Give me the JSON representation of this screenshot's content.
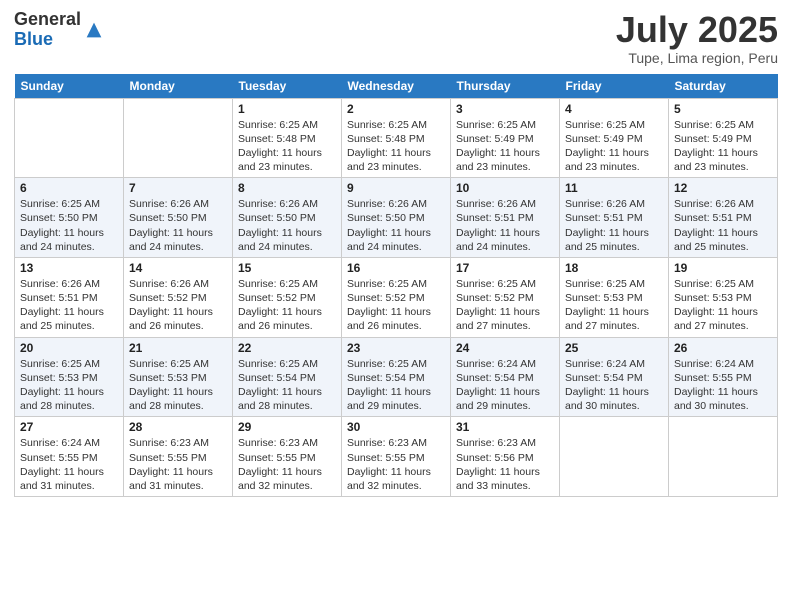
{
  "logo": {
    "general": "General",
    "blue": "Blue"
  },
  "title": "July 2025",
  "location": "Tupe, Lima region, Peru",
  "days_of_week": [
    "Sunday",
    "Monday",
    "Tuesday",
    "Wednesday",
    "Thursday",
    "Friday",
    "Saturday"
  ],
  "weeks": [
    [
      {
        "day": "",
        "info": ""
      },
      {
        "day": "",
        "info": ""
      },
      {
        "day": "1",
        "info": "Sunrise: 6:25 AM\nSunset: 5:48 PM\nDaylight: 11 hours and 23 minutes."
      },
      {
        "day": "2",
        "info": "Sunrise: 6:25 AM\nSunset: 5:48 PM\nDaylight: 11 hours and 23 minutes."
      },
      {
        "day": "3",
        "info": "Sunrise: 6:25 AM\nSunset: 5:49 PM\nDaylight: 11 hours and 23 minutes."
      },
      {
        "day": "4",
        "info": "Sunrise: 6:25 AM\nSunset: 5:49 PM\nDaylight: 11 hours and 23 minutes."
      },
      {
        "day": "5",
        "info": "Sunrise: 6:25 AM\nSunset: 5:49 PM\nDaylight: 11 hours and 23 minutes."
      }
    ],
    [
      {
        "day": "6",
        "info": "Sunrise: 6:25 AM\nSunset: 5:50 PM\nDaylight: 11 hours and 24 minutes."
      },
      {
        "day": "7",
        "info": "Sunrise: 6:26 AM\nSunset: 5:50 PM\nDaylight: 11 hours and 24 minutes."
      },
      {
        "day": "8",
        "info": "Sunrise: 6:26 AM\nSunset: 5:50 PM\nDaylight: 11 hours and 24 minutes."
      },
      {
        "day": "9",
        "info": "Sunrise: 6:26 AM\nSunset: 5:50 PM\nDaylight: 11 hours and 24 minutes."
      },
      {
        "day": "10",
        "info": "Sunrise: 6:26 AM\nSunset: 5:51 PM\nDaylight: 11 hours and 24 minutes."
      },
      {
        "day": "11",
        "info": "Sunrise: 6:26 AM\nSunset: 5:51 PM\nDaylight: 11 hours and 25 minutes."
      },
      {
        "day": "12",
        "info": "Sunrise: 6:26 AM\nSunset: 5:51 PM\nDaylight: 11 hours and 25 minutes."
      }
    ],
    [
      {
        "day": "13",
        "info": "Sunrise: 6:26 AM\nSunset: 5:51 PM\nDaylight: 11 hours and 25 minutes."
      },
      {
        "day": "14",
        "info": "Sunrise: 6:26 AM\nSunset: 5:52 PM\nDaylight: 11 hours and 26 minutes."
      },
      {
        "day": "15",
        "info": "Sunrise: 6:25 AM\nSunset: 5:52 PM\nDaylight: 11 hours and 26 minutes."
      },
      {
        "day": "16",
        "info": "Sunrise: 6:25 AM\nSunset: 5:52 PM\nDaylight: 11 hours and 26 minutes."
      },
      {
        "day": "17",
        "info": "Sunrise: 6:25 AM\nSunset: 5:52 PM\nDaylight: 11 hours and 27 minutes."
      },
      {
        "day": "18",
        "info": "Sunrise: 6:25 AM\nSunset: 5:53 PM\nDaylight: 11 hours and 27 minutes."
      },
      {
        "day": "19",
        "info": "Sunrise: 6:25 AM\nSunset: 5:53 PM\nDaylight: 11 hours and 27 minutes."
      }
    ],
    [
      {
        "day": "20",
        "info": "Sunrise: 6:25 AM\nSunset: 5:53 PM\nDaylight: 11 hours and 28 minutes."
      },
      {
        "day": "21",
        "info": "Sunrise: 6:25 AM\nSunset: 5:53 PM\nDaylight: 11 hours and 28 minutes."
      },
      {
        "day": "22",
        "info": "Sunrise: 6:25 AM\nSunset: 5:54 PM\nDaylight: 11 hours and 28 minutes."
      },
      {
        "day": "23",
        "info": "Sunrise: 6:25 AM\nSunset: 5:54 PM\nDaylight: 11 hours and 29 minutes."
      },
      {
        "day": "24",
        "info": "Sunrise: 6:24 AM\nSunset: 5:54 PM\nDaylight: 11 hours and 29 minutes."
      },
      {
        "day": "25",
        "info": "Sunrise: 6:24 AM\nSunset: 5:54 PM\nDaylight: 11 hours and 30 minutes."
      },
      {
        "day": "26",
        "info": "Sunrise: 6:24 AM\nSunset: 5:55 PM\nDaylight: 11 hours and 30 minutes."
      }
    ],
    [
      {
        "day": "27",
        "info": "Sunrise: 6:24 AM\nSunset: 5:55 PM\nDaylight: 11 hours and 31 minutes."
      },
      {
        "day": "28",
        "info": "Sunrise: 6:23 AM\nSunset: 5:55 PM\nDaylight: 11 hours and 31 minutes."
      },
      {
        "day": "29",
        "info": "Sunrise: 6:23 AM\nSunset: 5:55 PM\nDaylight: 11 hours and 32 minutes."
      },
      {
        "day": "30",
        "info": "Sunrise: 6:23 AM\nSunset: 5:55 PM\nDaylight: 11 hours and 32 minutes."
      },
      {
        "day": "31",
        "info": "Sunrise: 6:23 AM\nSunset: 5:56 PM\nDaylight: 11 hours and 33 minutes."
      },
      {
        "day": "",
        "info": ""
      },
      {
        "day": "",
        "info": ""
      }
    ]
  ]
}
